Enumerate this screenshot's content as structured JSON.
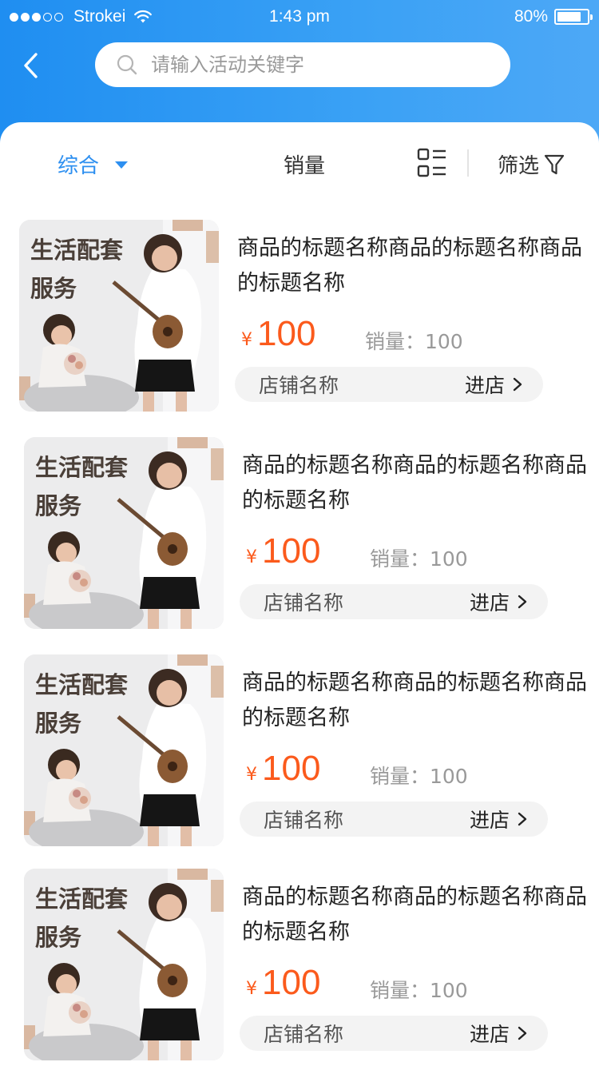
{
  "status_bar": {
    "carrier": "Strokei",
    "time": "1:43 pm",
    "battery": "80%",
    "battery_level": 0.8
  },
  "search": {
    "placeholder": "请输入活动关键字"
  },
  "filters": {
    "comprehensive": "综合",
    "sales": "销量",
    "filter": "筛选"
  },
  "products": [
    {
      "image_text_line1": "生活配套",
      "image_text_line2": "服务",
      "title": "商品的标题名称商品的标题名称商品的标题名称",
      "currency": "¥",
      "price": "100",
      "sales": "销量：100",
      "shop_name": "店铺名称",
      "enter_shop": "进店"
    },
    {
      "image_text_line1": "生活配套",
      "image_text_line2": "服务",
      "title": "商品的标题名称商品的标题名称商品的标题名称",
      "currency": "¥",
      "price": "100",
      "sales": "销量：100",
      "shop_name": "店铺名称",
      "enter_shop": "进店"
    },
    {
      "image_text_line1": "生活配套",
      "image_text_line2": "服务",
      "title": "商品的标题名称商品的标题名称商品的标题名称",
      "currency": "¥",
      "price": "100",
      "sales": "销量：100",
      "shop_name": "店铺名称",
      "enter_shop": "进店"
    },
    {
      "image_text_line1": "生活配套",
      "image_text_line2": "服务",
      "title": "商品的标题名称商品的标题名称商品的标题名称",
      "currency": "¥",
      "price": "100",
      "sales": "销量：100",
      "shop_name": "店铺名称",
      "enter_shop": "进店"
    }
  ],
  "colors": {
    "header_blue": "#1f8ef1",
    "active_blue": "#2d8ff0",
    "price_orange": "#fb5a1c"
  }
}
